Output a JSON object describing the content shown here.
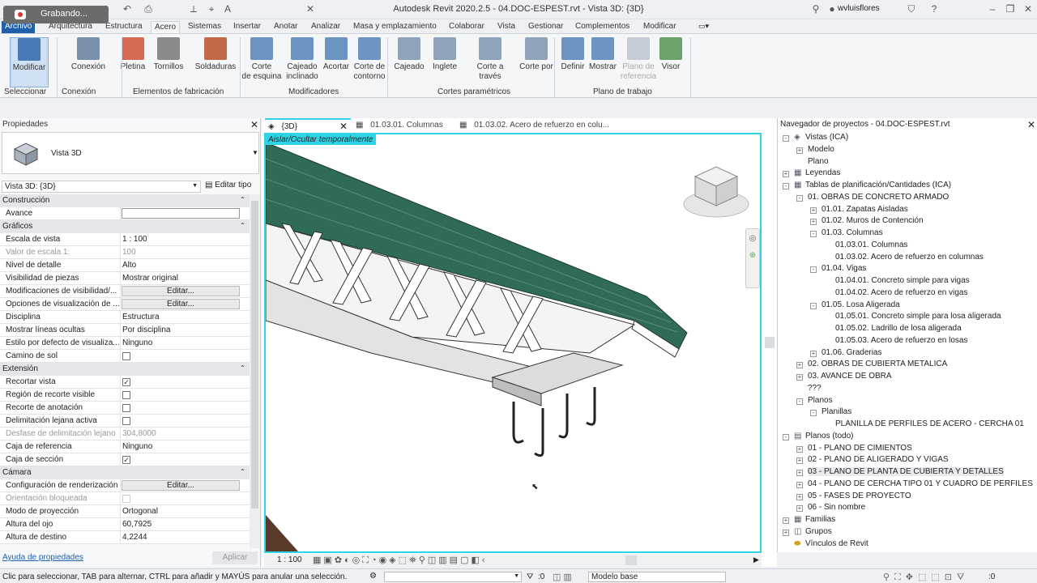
{
  "recording": {
    "label": "Grabando..."
  },
  "window": {
    "title": "Autodesk Revit 2020.2.5 - 04.DOC-ESPEST.rvt - Vista 3D: {3D}",
    "user": "wvluisflores"
  },
  "menu": [
    "Archivo",
    "Arquitectura",
    "Estructura",
    "Acero",
    "Sistemas",
    "Insertar",
    "Anotar",
    "Analizar",
    "Masa y emplazamiento",
    "Colaborar",
    "Vista",
    "Gestionar",
    "Complementos",
    "Modificar"
  ],
  "ribbon": {
    "buttons": [
      {
        "label": "Modificar",
        "color": "#4a7ab8"
      },
      {
        "label": "Conexión",
        "color": "#7a8fa8"
      },
      {
        "label": "Pletina",
        "color": "#d56a55"
      },
      {
        "label": "Tornillos",
        "color": "#8a8a8a"
      },
      {
        "label": "Soldaduras",
        "color": "#c06a4a"
      },
      {
        "label": "Corte\nde esquina",
        "color": "#6d93c2"
      },
      {
        "label": "Cajeado\ninclinado",
        "color": "#6d93c2"
      },
      {
        "label": "Acortar",
        "color": "#6d93c2"
      },
      {
        "label": "Corte de\ncontorno",
        "color": "#6d93c2"
      },
      {
        "label": "Cajeado",
        "color": "#8fa3b8"
      },
      {
        "label": "Inglete",
        "color": "#8fa3b8"
      },
      {
        "label": "Corte a través",
        "color": "#8fa3b8"
      },
      {
        "label": "Corte por",
        "color": "#8fa3b8"
      },
      {
        "label": "Definir",
        "color": "#6d93c2"
      },
      {
        "label": "Mostrar",
        "color": "#6d93c2"
      },
      {
        "label": "Plano de\nreferencia",
        "color": "#c5ccd6"
      },
      {
        "label": "Visor",
        "color": "#6aa26a"
      }
    ],
    "groups": [
      "Seleccionar",
      "Conexión",
      "Elementos de fabricación",
      "Modificadores",
      "Cortes paramétricos",
      "Plano de trabajo"
    ]
  },
  "properties": {
    "title": "Propiedades",
    "type_name": "Vista 3D",
    "selector": "Vista 3D: {3D}",
    "edit_type": "Editar tipo",
    "help_link": "Ayuda de propiedades",
    "apply": "Aplicar",
    "cat_construccion": "Construcción",
    "cat_graficos": "Gráficos",
    "cat_extension": "Extensión",
    "cat_camara": "Cámara",
    "rows": {
      "avance": "Avance",
      "escala": "Escala de vista",
      "escala_v": "1 : 100",
      "valor_escala": "Valor de escala    1:",
      "valor_escala_v": "100",
      "nivel": "Nivel de detalle",
      "nivel_v": "Alto",
      "visib_piezas": "Visibilidad de piezas",
      "visib_piezas_v": "Mostrar original",
      "mod_visib": "Modificaciones de visibilidad/...",
      "opc_visual": "Opciones de visualización de ...",
      "edit": "Editar...",
      "disciplina": "Disciplina",
      "disciplina_v": "Estructura",
      "lineas": "Mostrar líneas ocultas",
      "lineas_v": "Por disciplina",
      "estilo": "Estilo por defecto de visualiza...",
      "estilo_v": "Ninguno",
      "sol": "Camino de sol",
      "recortar": "Recortar vista",
      "region": "Región de recorte visible",
      "recorte_anot": "Recorte de anotación",
      "delim": "Delimitación lejana activa",
      "desfase": "Desfase de delimitación lejano",
      "desfase_v": "304,8000",
      "caja_ref": "Caja de referencia",
      "caja_ref_v": "Ninguno",
      "caja_sec": "Caja de sección",
      "render": "Configuración de renderización",
      "orient": "Orientación bloqueada",
      "modo": "Modo de proyección",
      "modo_v": "Ortogonal",
      "ojo": "Altura del ojo",
      "ojo_v": "60,7925",
      "destino": "Altura de destino",
      "destino_v": "4,2244"
    }
  },
  "view": {
    "tabs": [
      "{3D}",
      "01.03.01. Columnas",
      "01.03.02. Acero de refuerzo en colu..."
    ],
    "temp_label": "Aislar/Ocultar temporalmente",
    "scale": "1 : 100"
  },
  "navigator": {
    "title": "Navegador de proyectos - 04.DOC-ESPEST.rvt",
    "items": [
      "Vistas (ICA)",
      "Modelo",
      "Plano",
      "Leyendas",
      "Tablas de planificación/Cantidades (ICA)",
      "01. OBRAS DE CONCRETO ARMADO",
      "01.01. Zapatas Aisladas",
      "01.02. Muros de Contención",
      "01.03. Columnas",
      "01.03.01. Columnas",
      "01.03.02. Acero de refuerzo en columnas",
      "01.04. Vigas",
      "01.04.01. Concreto simple para vigas",
      "01.04.02. Acero de refuerzo en vigas",
      "01.05. Losa Aligerada",
      "01.05.01. Concreto simple para losa aligerada",
      "01.05.02. Ladrillo de losa aligerada",
      "01.05.03. Acero de refuerzo en losas",
      "01.06. Graderias",
      "02. OBRAS DE CUBIERTA METALICA",
      "03. AVANCE DE OBRA",
      "???",
      "Planos",
      "Planillas",
      "PLANILLA DE PERFILES DE ACERO - CERCHA 01",
      "Planos (todo)",
      "01 - PLANO DE CIMIENTOS",
      "02 - PLANO DE ALIGERADO Y VIGAS",
      "03 - PLANO DE PLANTA DE CUBIERTA Y DETALLES",
      "04 - PLANO DE CERCHA TIPO 01 Y CUADRO DE PERFILES",
      "05 - FASES DE PROYECTO",
      "06 - Sin nombre",
      "Familias",
      "Grupos",
      "Vínculos de Revit"
    ]
  },
  "status": {
    "hint": "Clic para seleccionar, TAB para alternar, CTRL para añadir y MAYÚS para anular una selección.",
    "zero": ":0",
    "model": "Modelo base"
  }
}
